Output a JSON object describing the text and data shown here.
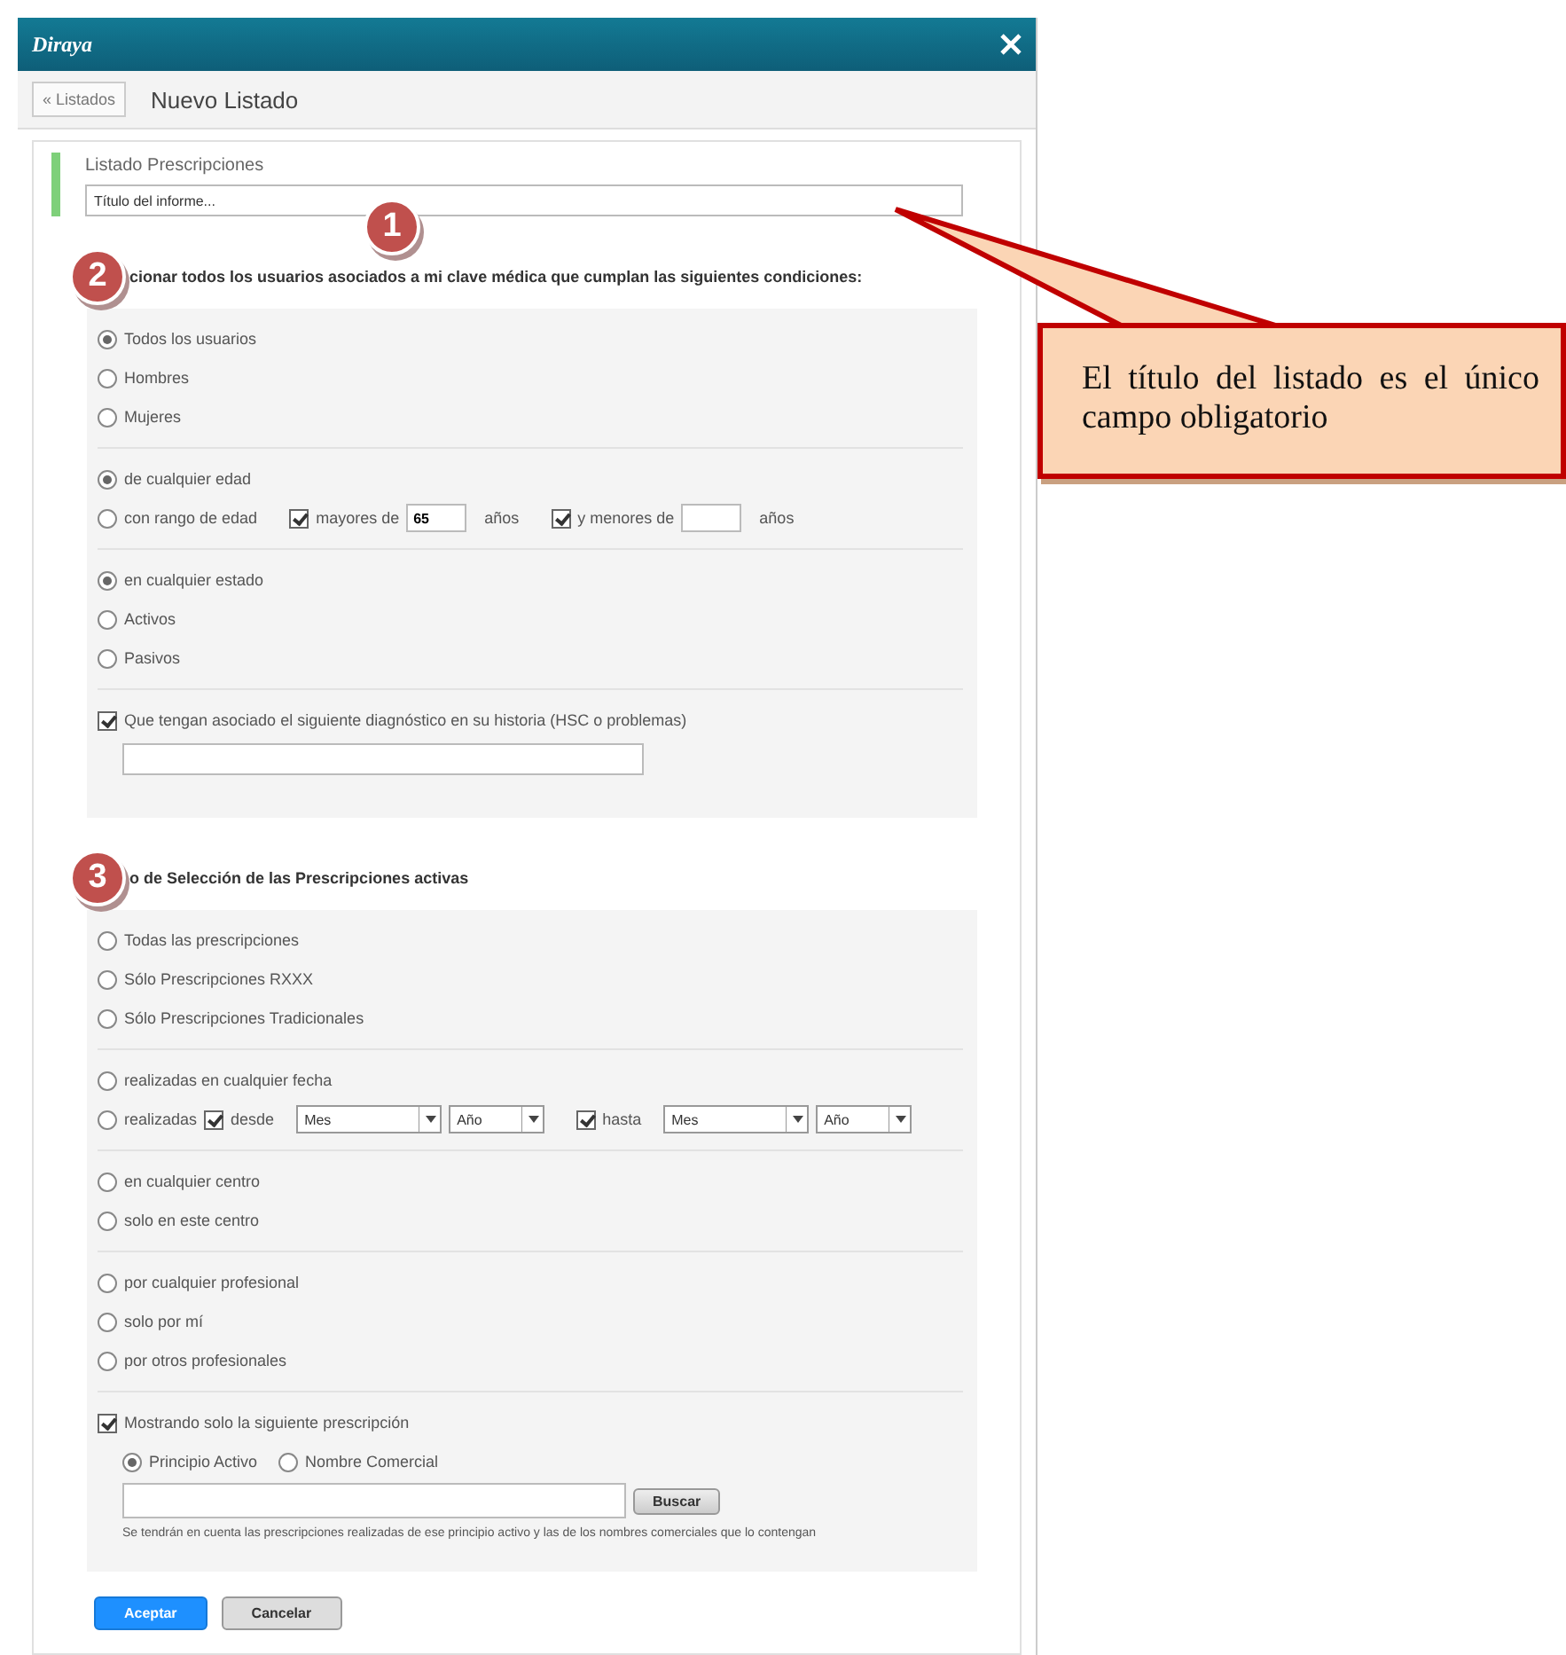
{
  "header": {
    "logo": "Diraya"
  },
  "toolbar": {
    "back_button": "« Listados",
    "title": "Nuevo Listado"
  },
  "form": {
    "heading": "Listado Prescripciones",
    "title_field": {
      "placeholder": "Título del informe..."
    },
    "badge": "1"
  },
  "sections": [
    {
      "badge": "2",
      "title": "cionar todos los usuarios asociados a mi clave médica que cumplan las siguientes condiciones:",
      "groups": [
        [
          {
            "kind": "radio",
            "label": "Todos los usuarios",
            "selected": true
          },
          {
            "kind": "radio",
            "label": "Hombres",
            "selected": false
          },
          {
            "kind": "radio",
            "label": "Mujeres",
            "selected": false
          }
        ],
        [
          {
            "kind": "radio",
            "label": "de cualquier edad",
            "selected": true
          },
          {
            "kind": "age_range",
            "label": "con rango de edad",
            "selected": false,
            "from": {
              "label": "mayores de",
              "checked": true,
              "value": "65",
              "unit": "años"
            },
            "to": {
              "label": "y menores de",
              "checked": true,
              "unit": "años"
            }
          }
        ],
        [
          {
            "kind": "radio",
            "label": "en cualquier estado",
            "selected": true
          },
          {
            "kind": "radio",
            "label": "Activos",
            "selected": false
          },
          {
            "kind": "radio",
            "label": "Pasivos",
            "selected": false
          }
        ],
        [
          {
            "kind": "checkbox_field",
            "label": "Que tengan asociado el siguiente diagnóstico en su  historia (HSC o  problemas)",
            "checked": true
          }
        ]
      ]
    },
    {
      "badge": "3",
      "title": "o de Selección de las Prescripciones activas",
      "groups": [
        [
          {
            "kind": "radio",
            "label": "Todas las prescripciones",
            "selected": false
          },
          {
            "kind": "radio",
            "label": "Sólo Prescripciones RXXX",
            "selected": false
          },
          {
            "kind": "radio",
            "label": "Sólo Prescripciones Tradicionales",
            "selected": false
          }
        ],
        [
          {
            "kind": "radio",
            "label": "realizadas en cualquier fecha",
            "selected": false
          },
          {
            "kind": "date_range",
            "label": "realizadas",
            "selected": false,
            "from": {
              "label": "desde",
              "checked": true,
              "month": "Mes",
              "year": "Año"
            },
            "to": {
              "label": "hasta",
              "checked": true,
              "month": "Mes",
              "year": "Año"
            }
          }
        ],
        [
          {
            "kind": "radio",
            "label": "en cualquier centro",
            "selected": false
          },
          {
            "kind": "radio",
            "label": "solo en este centro",
            "selected": false
          }
        ],
        [
          {
            "kind": "radio",
            "label": "por cualquier profesional",
            "selected": false
          },
          {
            "kind": "radio",
            "label": "solo por mí",
            "selected": false
          },
          {
            "kind": "radio",
            "label": "por otros profesionales",
            "selected": false
          }
        ],
        [
          {
            "kind": "drug_search",
            "label": "Mostrando solo la siguiente prescripción",
            "checked": true,
            "options": [
              {
                "label": "Principio Activo",
                "selected": true
              },
              {
                "label": "Nombre Comercial",
                "selected": false
              }
            ],
            "button": "Buscar",
            "note": "Se tendrán en cuenta las prescripciones realizadas de ese principio activo y las de los nombres comerciales que lo contengan"
          }
        ]
      ]
    }
  ],
  "actions": [
    {
      "label": "Aceptar",
      "primary": true
    },
    {
      "label": "Cancelar",
      "primary": false
    }
  ],
  "callout": {
    "text": "El título del listado es el único campo obligatorio"
  }
}
